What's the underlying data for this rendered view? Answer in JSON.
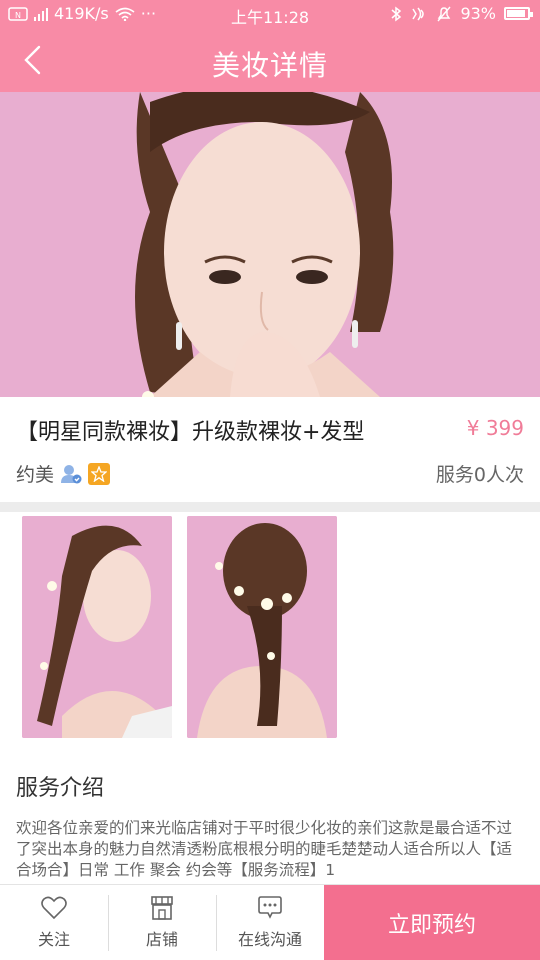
{
  "status_bar": {
    "network_speed": "419K/s",
    "dots": "···",
    "time": "上午11:28",
    "battery_percent": "93%",
    "battery_level": 0.93
  },
  "nav": {
    "title": "美妆详情",
    "back_icon": "chevron-left-icon"
  },
  "product": {
    "title": "【明星同款裸妆】升级款裸妆+发型",
    "price": "¥ 399",
    "shop_name": "约美",
    "served_count": "服务0人次"
  },
  "service": {
    "section_title": "服务介绍",
    "description": "欢迎各位亲爱的们来光临店铺对于平时很少化妆的亲们这款是最合适不过了突出本身的魅力自然清透粉底根根分明的睫毛楚楚动人适合所以人【适合场合】日常 工作 聚会 约会等【服务流程】1"
  },
  "bottom_bar": {
    "follow_label": "关注",
    "shop_label": "店铺",
    "chat_label": "在线沟通",
    "book_label": "立即预约"
  },
  "colors": {
    "brand_pink": "#f88ba6",
    "cta_pink": "#f36f8f",
    "price_pink": "#f07c98",
    "photo_bg": "#e8aed0"
  }
}
